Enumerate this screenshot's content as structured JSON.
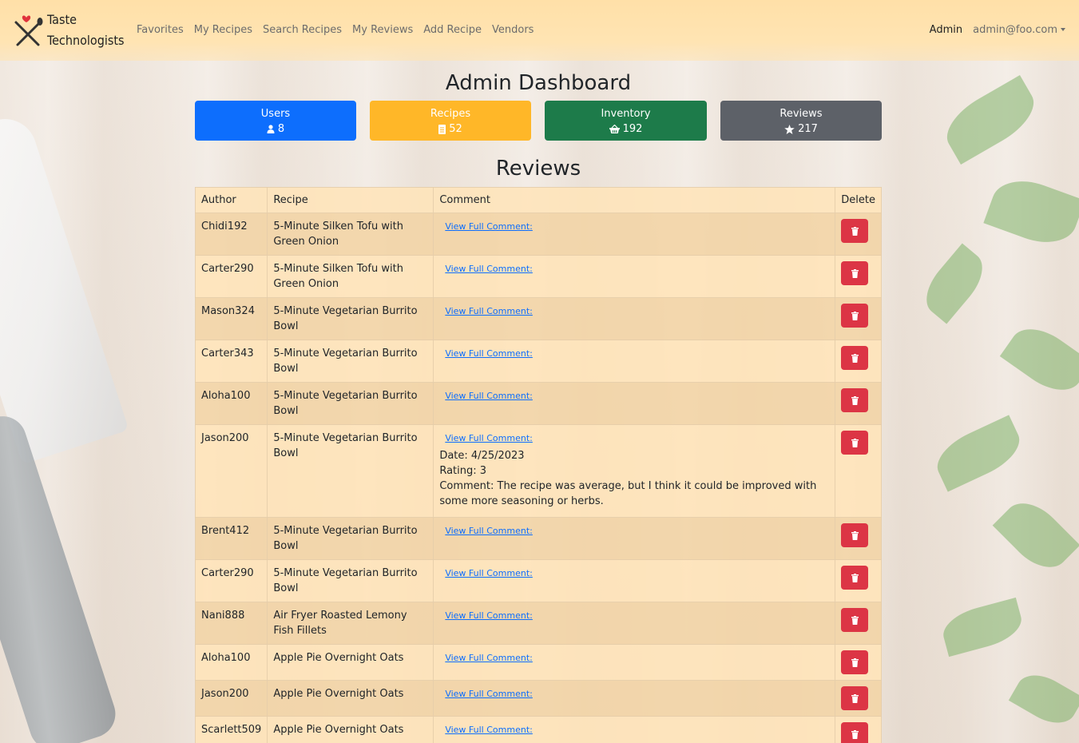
{
  "brand": {
    "line1": "Taste",
    "line2": "Technologists"
  },
  "nav": {
    "links": [
      "Favorites",
      "My Recipes",
      "Search Recipes",
      "My Reviews",
      "Add Recipe",
      "Vendors"
    ],
    "admin": "Admin",
    "user_email": "admin@foo.com"
  },
  "page_title": "Admin Dashboard",
  "stats": {
    "users": {
      "label": "Users",
      "value": "8",
      "color": "#0d6efd",
      "icon": "person-icon"
    },
    "recipes": {
      "label": "Recipes",
      "value": "52",
      "color": "#ffb728",
      "icon": "document-icon"
    },
    "inventory": {
      "label": "Inventory",
      "value": "192",
      "color": "#1d7b4a",
      "icon": "basket-icon"
    },
    "reviews": {
      "label": "Reviews",
      "value": "217",
      "color": "#5d6168",
      "icon": "star-icon"
    }
  },
  "reviews_title": "Reviews",
  "table": {
    "headers": {
      "author": "Author",
      "recipe": "Recipe",
      "comment": "Comment",
      "delete": "Delete"
    },
    "view_label": "View Full Comment:",
    "rows": [
      {
        "author": "Chidi192",
        "recipe": "5-Minute Silken Tofu with Green Onion"
      },
      {
        "author": "Carter290",
        "recipe": "5-Minute Silken Tofu with Green Onion"
      },
      {
        "author": "Mason324",
        "recipe": "5-Minute Vegetarian Burrito Bowl"
      },
      {
        "author": "Carter343",
        "recipe": "5-Minute Vegetarian Burrito Bowl"
      },
      {
        "author": "Aloha100",
        "recipe": "5-Minute Vegetarian Burrito Bowl"
      },
      {
        "author": "Jason200",
        "recipe": "5-Minute Vegetarian Burrito Bowl",
        "expanded": {
          "date": "Date: 4/25/2023",
          "rating": "Rating: 3",
          "comment": "Comment: The recipe was average, but I think it could be improved with some more seasoning or herbs."
        }
      },
      {
        "author": "Brent412",
        "recipe": "5-Minute Vegetarian Burrito Bowl"
      },
      {
        "author": "Carter290",
        "recipe": "5-Minute Vegetarian Burrito Bowl"
      },
      {
        "author": "Nani888",
        "recipe": "Air Fryer Roasted Lemony Fish Fillets"
      },
      {
        "author": "Aloha100",
        "recipe": "Apple Pie Overnight Oats"
      },
      {
        "author": "Jason200",
        "recipe": "Apple Pie Overnight Oats"
      },
      {
        "author": "Scarlett509",
        "recipe": "Apple Pie Overnight Oats"
      }
    ]
  }
}
